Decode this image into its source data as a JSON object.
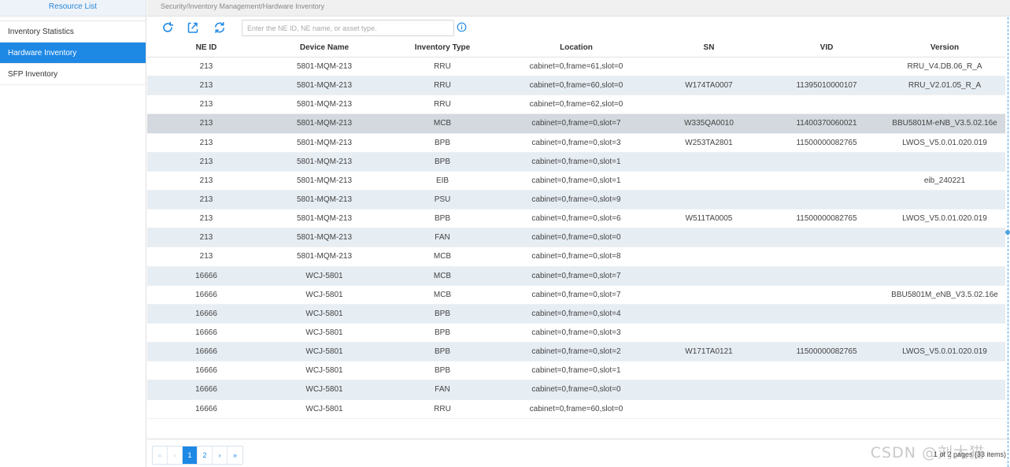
{
  "sidebar": {
    "header": "Resource List",
    "items": [
      {
        "label": "Inventory Statistics",
        "active": false
      },
      {
        "label": "Hardware Inventory",
        "active": true
      },
      {
        "label": "SFP Inventory",
        "active": false
      }
    ]
  },
  "breadcrumb": "Security/Inventory Management/Hardware Inventory",
  "toolbar": {
    "icons": [
      "refresh-icon",
      "export-icon",
      "sync-icon"
    ],
    "search_placeholder": "Enter the NE ID, NE name, or asset type.",
    "search_value": "",
    "info_icon": "info-icon"
  },
  "table": {
    "columns": [
      "NE ID",
      "Device Name",
      "Inventory Type",
      "Location",
      "SN",
      "VID",
      "Version"
    ],
    "selected_row": 3,
    "rows": [
      [
        "213",
        "5801-MQM-213",
        "RRU",
        "cabinet=0,frame=61,slot=0",
        "",
        "",
        "RRU_V4.DB.06_R_A"
      ],
      [
        "213",
        "5801-MQM-213",
        "RRU",
        "cabinet=0,frame=60,slot=0",
        "W174TA0007",
        "11395010000107",
        "RRU_V2.01.05_R_A"
      ],
      [
        "213",
        "5801-MQM-213",
        "RRU",
        "cabinet=0,frame=62,slot=0",
        "",
        "",
        ""
      ],
      [
        "213",
        "5801-MQM-213",
        "MCB",
        "cabinet=0,frame=0,slot=7",
        "W335QA0010",
        "11400370060021",
        "BBU5801M-eNB_V3.5.02.16e"
      ],
      [
        "213",
        "5801-MQM-213",
        "BPB",
        "cabinet=0,frame=0,slot=3",
        "W253TA2801",
        "11500000082765",
        "LWOS_V5.0.01.020.019"
      ],
      [
        "213",
        "5801-MQM-213",
        "BPB",
        "cabinet=0,frame=0,slot=1",
        "",
        "",
        ""
      ],
      [
        "213",
        "5801-MQM-213",
        "EIB",
        "cabinet=0,frame=0,slot=1",
        "",
        "",
        "eib_240221"
      ],
      [
        "213",
        "5801-MQM-213",
        "PSU",
        "cabinet=0,frame=0,slot=9",
        "",
        "",
        ""
      ],
      [
        "213",
        "5801-MQM-213",
        "BPB",
        "cabinet=0,frame=0,slot=6",
        "W511TA0005",
        "11500000082765",
        "LWOS_V5.0.01.020.019"
      ],
      [
        "213",
        "5801-MQM-213",
        "FAN",
        "cabinet=0,frame=0,slot=0",
        "",
        "",
        ""
      ],
      [
        "213",
        "5801-MQM-213",
        "MCB",
        "cabinet=0,frame=0,slot=8",
        "",
        "",
        ""
      ],
      [
        "16666",
        "WCJ-5801",
        "MCB",
        "cabinet=0,frame=0,slot=7",
        "",
        "",
        ""
      ],
      [
        "16666",
        "WCJ-5801",
        "MCB",
        "cabinet=0,frame=0,slot=7",
        "",
        "",
        "BBU5801M_eNB_V3.5.02.16e"
      ],
      [
        "16666",
        "WCJ-5801",
        "BPB",
        "cabinet=0,frame=0,slot=4",
        "",
        "",
        ""
      ],
      [
        "16666",
        "WCJ-5801",
        "BPB",
        "cabinet=0,frame=0,slot=3",
        "",
        "",
        ""
      ],
      [
        "16666",
        "WCJ-5801",
        "BPB",
        "cabinet=0,frame=0,slot=2",
        "W171TA0121",
        "11500000082765",
        "LWOS_V5.0.01.020.019"
      ],
      [
        "16666",
        "WCJ-5801",
        "BPB",
        "cabinet=0,frame=0,slot=1",
        "",
        "",
        ""
      ],
      [
        "16666",
        "WCJ-5801",
        "FAN",
        "cabinet=0,frame=0,slot=0",
        "",
        "",
        ""
      ],
      [
        "16666",
        "WCJ-5801",
        "RRU",
        "cabinet=0,frame=60,slot=0",
        "",
        "",
        ""
      ]
    ]
  },
  "pagination": {
    "first": "«",
    "prev": "‹",
    "pages": [
      "1",
      "2"
    ],
    "current": "1",
    "next": "›",
    "last": "»",
    "info": "1 of 2 pages (33 items)"
  },
  "watermark": "CSDN @刘大猫",
  "colors": {
    "accent": "#1e88e5",
    "alt_row": "#e6edf3",
    "selected_row": "#d3d9de"
  }
}
